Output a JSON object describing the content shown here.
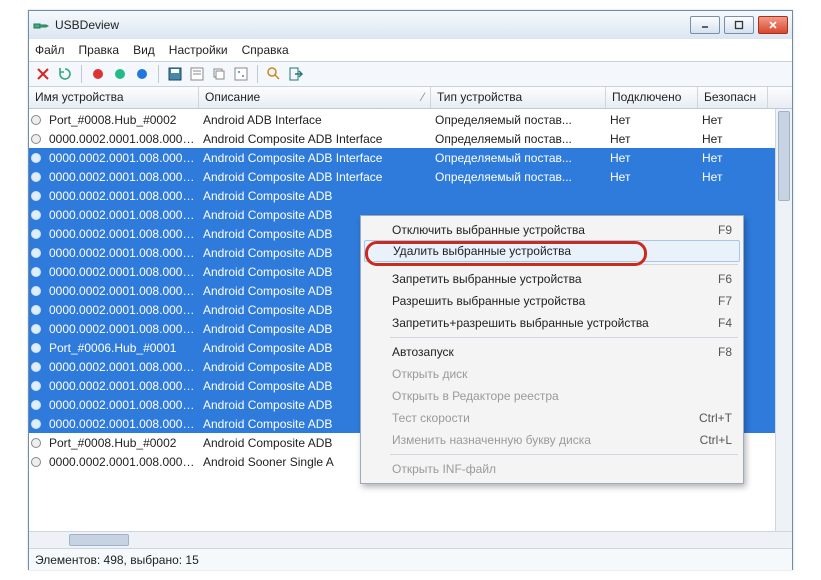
{
  "window": {
    "title": "USBDeview"
  },
  "menu": {
    "file": "Файл",
    "edit": "Правка",
    "view": "Вид",
    "settings": "Настройки",
    "help": "Справка"
  },
  "headers": {
    "name": "Имя устройства",
    "desc": "Описание",
    "type": "Тип устройства",
    "connected": "Подключено",
    "safe": "Безопасн"
  },
  "statusbar": "Элементов: 498, выбрано: 15",
  "type_default": "Определяемый постав...",
  "val_no": "Нет",
  "rows": [
    {
      "sel": false,
      "name": "Port_#0008.Hub_#0002",
      "desc": "Android ADB Interface"
    },
    {
      "sel": false,
      "name": "0000.0002.0001.008.000.0...",
      "desc": "Android Composite ADB Interface"
    },
    {
      "sel": true,
      "name": "0000.0002.0001.008.000.0...",
      "desc": "Android Composite ADB Interface"
    },
    {
      "sel": true,
      "name": "0000.0002.0001.008.000.0...",
      "desc": "Android Composite ADB Interface"
    },
    {
      "sel": true,
      "name": "0000.0002.0001.008.000.0...",
      "desc": "Android Composite ADB"
    },
    {
      "sel": true,
      "name": "0000.0002.0001.008.000.0...",
      "desc": "Android Composite ADB"
    },
    {
      "sel": true,
      "name": "0000.0002.0001.008.000.0...",
      "desc": "Android Composite ADB"
    },
    {
      "sel": true,
      "name": "0000.0002.0001.008.000.0...",
      "desc": "Android Composite ADB"
    },
    {
      "sel": true,
      "name": "0000.0002.0001.008.000.0...",
      "desc": "Android Composite ADB"
    },
    {
      "sel": true,
      "name": "0000.0002.0001.008.000.0...",
      "desc": "Android Composite ADB"
    },
    {
      "sel": true,
      "name": "0000.0002.0001.008.000.0...",
      "desc": "Android Composite ADB"
    },
    {
      "sel": true,
      "name": "0000.0002.0001.008.000.0...",
      "desc": "Android Composite ADB"
    },
    {
      "sel": true,
      "name": "Port_#0006.Hub_#0001",
      "desc": "Android Composite ADB"
    },
    {
      "sel": true,
      "name": "0000.0002.0001.008.000.0...",
      "desc": "Android Composite ADB"
    },
    {
      "sel": true,
      "name": "0000.0002.0001.008.000.0...",
      "desc": "Android Composite ADB"
    },
    {
      "sel": true,
      "name": "0000.0002.0001.008.000.0...",
      "desc": "Android Composite ADB"
    },
    {
      "sel": true,
      "name": "0000.0002.0001.008.000.0...",
      "desc": "Android Composite ADB"
    },
    {
      "sel": false,
      "name": "Port_#0008.Hub_#0002",
      "desc": "Android Composite ADB"
    },
    {
      "sel": false,
      "name": "0000.0002.0001.008.000.0...",
      "desc": "Android Sooner Single A"
    }
  ],
  "context": {
    "disconnect": "Отключить выбранные устройства",
    "disconnect_sc": "F9",
    "delete": "Удалить выбранные устройства",
    "disable": "Запретить выбранные устройства",
    "disable_sc": "F6",
    "enable": "Разрешить выбранные устройства",
    "enable_sc": "F7",
    "toggle": "Запретить+разрешить выбранные устройства",
    "toggle_sc": "F4",
    "autorun": "Автозапуск",
    "autorun_sc": "F8",
    "opendisk": "Открыть диск",
    "regedit": "Открыть в Редакторе реестра",
    "speed": "Тест скорости",
    "speed_sc": "Ctrl+T",
    "drive": "Изменить назначенную букву диска",
    "drive_sc": "Ctrl+L",
    "inf": "Открыть INF-файл"
  }
}
